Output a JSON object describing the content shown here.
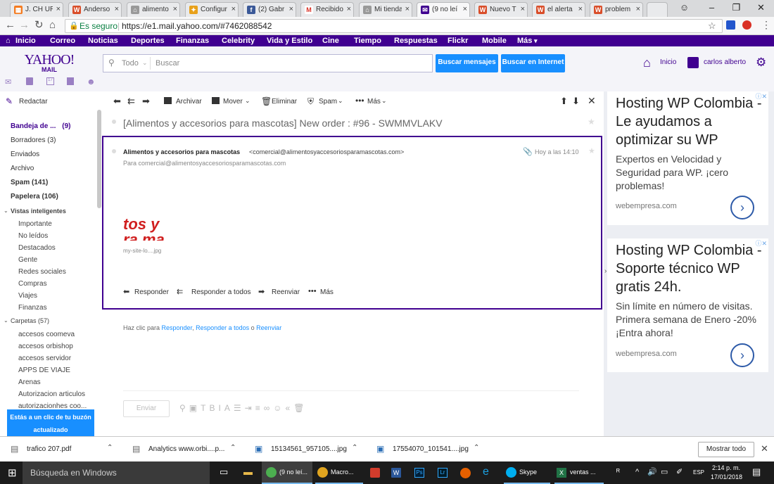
{
  "browser": {
    "tabs": [
      {
        "label": "J. CH UR",
        "icon": "orange-grid-icon",
        "color": "#f47b20"
      },
      {
        "label": "Anderso",
        "icon": "w-icon",
        "color": "#d94e2a"
      },
      {
        "label": "alimento",
        "icon": "shop-icon",
        "color": "#666666"
      },
      {
        "label": "Configur",
        "icon": "configure-icon",
        "color": "#e8a11a"
      },
      {
        "label": "(2) Gabr",
        "icon": "facebook-icon",
        "color": "#3b5998"
      },
      {
        "label": "Recibido",
        "icon": "gmail-icon",
        "color": "#d93025"
      },
      {
        "label": "Mi tienda",
        "icon": "shop-icon",
        "color": "#666666"
      },
      {
        "label": "(9 no leí",
        "icon": "mail-icon",
        "color": "#400090"
      },
      {
        "label": "Nuevo T",
        "icon": "w-icon",
        "color": "#d94e2a"
      },
      {
        "label": "el alerta",
        "icon": "w-icon",
        "color": "#d94e2a"
      },
      {
        "label": "problem",
        "icon": "w-icon",
        "color": "#d94e2a"
      }
    ],
    "secure_label": "Es seguro",
    "url": "https://e1.mail.yahoo.com/#7462088542"
  },
  "yahoo_menu": [
    "Inicio",
    "Correo",
    "Noticias",
    "Deportes",
    "Finanzas",
    "Celebrity",
    "Vida y Estilo",
    "Cine",
    "Tiempo",
    "Respuestas",
    "Flickr",
    "Mobile",
    "Más"
  ],
  "header": {
    "logo_top": "YAHOO!",
    "logo_bottom": "MAIL",
    "search_scope": "Todo",
    "search_placeholder": "Buscar",
    "search_mail_btn": "Buscar mensajes",
    "search_web_btn": "Buscar en Internet",
    "home_label": "Inicio",
    "user_name": "carlos alberto"
  },
  "sidebar": {
    "compose": "Redactar",
    "folders": [
      {
        "label": "Bandeja de ...",
        "count": "(9)"
      },
      {
        "label": "Borradores (3)"
      },
      {
        "label": "Enviados"
      },
      {
        "label": "Archivo"
      },
      {
        "label": "Spam (141)"
      },
      {
        "label": "Papelera (106)"
      }
    ],
    "smart_views_title": "Vistas inteligentes",
    "smart_views": [
      "Importante",
      "No leídos",
      "Destacados",
      "Gente",
      "Redes sociales",
      "Compras",
      "Viajes",
      "Finanzas"
    ],
    "folders_title": "Carpetas (57)",
    "user_folders": [
      "accesos coomeva",
      "accesos orbishop",
      "accesos servidor",
      "APPS DE VIAJE",
      "Arenas",
      "Autorizacion articulos",
      "autorizacionhes coo..."
    ],
    "update_notice": "Estás a un clic de tu buzón actualizado"
  },
  "toolbar": {
    "archive": "Archivar",
    "move": "Mover",
    "delete": "Eliminar",
    "spam": "Spam",
    "more": "Más"
  },
  "message": {
    "subject": "[Alimentos y accesorios para mascotas] New order : #96 - SWMMVLAKV",
    "sender_name": "Alimentos y accesorios para mascotas",
    "sender_email": "<comercial@alimentosyaccesoriosparamascotas.com>",
    "to_line": "Para  comercial@alimentosyaccesoriosparamascotas.com",
    "time": "Hoy a las 14:10",
    "image_text_top": "tos y",
    "image_text_bottom": "ra ma",
    "image_caption": "my-site-lo....jpg",
    "reply": "Responder",
    "reply_all": "Responder a todos",
    "forward": "Reenviar",
    "more": "Más"
  },
  "quick_reply": {
    "prefix": "Haz clic para ",
    "reply": "Responder",
    "comma": ", ",
    "reply_all": "Responder a todos",
    "or": " o ",
    "forward": "Reenviar",
    "send": "Enviar"
  },
  "ads": [
    {
      "title": "Hosting WP Colombia - Le ayudamos a optimizar su WP",
      "body": "Expertos en Velocidad y Seguridad para WP. ¡cero problemas!",
      "domain": "webempresa.com"
    },
    {
      "title": "Hosting WP Colombia - Soporte técnico WP gratis 24h.",
      "body": "Sin límite en número de visitas. Primera semana de Enero -20% ¡Entra ahora!",
      "domain": "webempresa.com"
    }
  ],
  "downloads": {
    "items": [
      "trafico 207.pdf",
      "Analytics www.orbi....p...",
      "15134561_957105....jpg",
      "17554070_101541....jpg"
    ],
    "show_all": "Mostrar todo"
  },
  "taskbar": {
    "search": "Búsqueda en Windows",
    "apps": [
      "(9 no leí...",
      "Macro...",
      "Skype",
      "ventas ..."
    ],
    "lang": "ESP",
    "time": "2:14 p. m.",
    "date": "17/01/2018"
  },
  "colors": {
    "yahoo_purple": "#400090",
    "link_blue": "#188fff",
    "ad_arrow": "#2d5aa8"
  }
}
